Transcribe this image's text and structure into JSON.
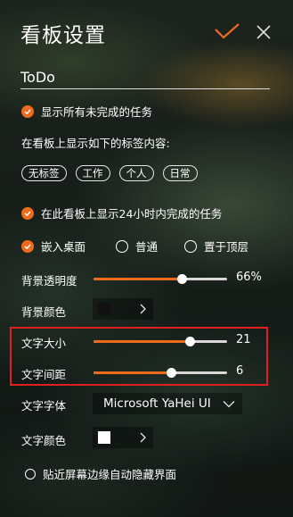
{
  "header": {
    "title": "看板设置",
    "confirm_icon": "checkmark-icon",
    "close_icon": "close-icon"
  },
  "board_name": {
    "value": "ToDo"
  },
  "options": {
    "show_all_incomplete": {
      "label": "显示所有未完成的任务",
      "checked": true
    },
    "tags_prompt": "在看板上显示如下的标签内容:",
    "tags": [
      "无标签",
      "工作",
      "个人",
      "日常"
    ],
    "show_completed_24h": {
      "label": "在此看板上显示24小时内完成的任务",
      "checked": true
    }
  },
  "mode": {
    "options": [
      {
        "label": "嵌入桌面",
        "selected": true
      },
      {
        "label": "普通",
        "selected": false
      },
      {
        "label": "置于顶层",
        "selected": false
      }
    ]
  },
  "opacity": {
    "label": "背景透明度",
    "value_text": "66%",
    "value": 0.66
  },
  "bg_color": {
    "label": "背景颜色",
    "color": "#111111"
  },
  "font_size": {
    "label": "文字大小",
    "value_text": "21",
    "fraction": 0.72
  },
  "line_spacing": {
    "label": "文字间距",
    "value_text": "6",
    "fraction": 0.58
  },
  "font_family": {
    "label": "文字字体",
    "value": "Microsoft YaHei UI"
  },
  "text_color": {
    "label": "文字颜色",
    "color": "#ffffff"
  },
  "auto_hide": {
    "label": "贴近屏幕边缘自动隐藏界面",
    "checked": false
  },
  "colors": {
    "accent": "#ee6a1c",
    "highlight_box": "#e02020"
  }
}
